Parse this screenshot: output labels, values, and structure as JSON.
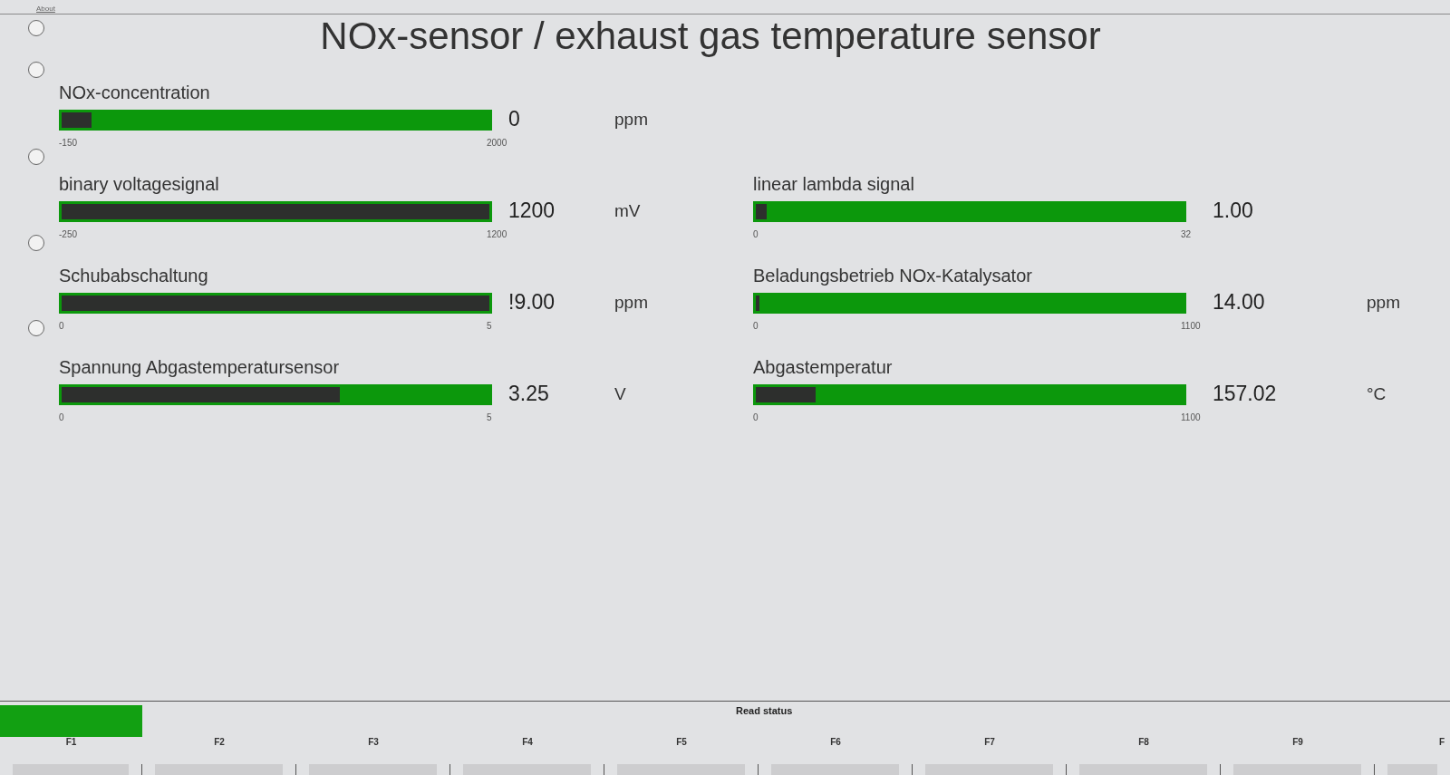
{
  "menu": [
    {
      "label": "About"
    }
  ],
  "title": "NOx-sensor / exhaust gas temperature sensor",
  "radio_buttons": [
    {
      "selected": false
    },
    {
      "selected": false
    },
    {
      "selected": false
    },
    {
      "selected": false
    },
    {
      "selected": false
    }
  ],
  "gauge_rows": [
    {
      "left": {
        "label": "NOx-concentration",
        "level": 0.07,
        "min": "-150",
        "max": "2000",
        "value": "0",
        "unit": "ppm"
      }
    },
    {
      "left": {
        "label": "binary voltagesignal",
        "level": 1,
        "min": "-250",
        "max": "1200",
        "value": "1200",
        "unit": "mV"
      },
      "right": {
        "label": "linear lambda signal",
        "level": 0.025,
        "min": "0",
        "max": "32",
        "value": "1.00"
      }
    },
    {
      "left": {
        "label": "Schubabschaltung",
        "level": 1,
        "min": "0",
        "max": "5",
        "value": "!9.00",
        "unit": "ppm"
      },
      "right": {
        "label": "Beladungsbetrieb NOx-Katalysator",
        "level": 0.008,
        "min": "0",
        "max": "1100",
        "value": "14.00",
        "unit": "ppm"
      }
    },
    {
      "left": {
        "label": "Spannung Abgastemperatursensor",
        "level": 0.65,
        "min": "0",
        "max": "5",
        "value": "3.25",
        "unit": "V"
      },
      "right": {
        "label": "Abgastemperatur",
        "level": 0.14,
        "min": "0",
        "max": "1100",
        "value": "157.02",
        "unit": "°C"
      }
    }
  ],
  "status_bar": {
    "text": "Read status"
  },
  "function_keys": [
    "F1",
    "F2",
    "F3",
    "F4",
    "F5",
    "F6",
    "F7",
    "F8",
    "F9",
    "F"
  ]
}
